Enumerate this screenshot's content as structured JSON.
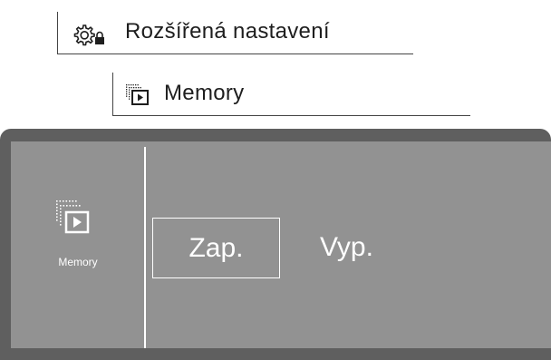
{
  "breadcrumb": {
    "level1": {
      "label": "Rozšířená nastavení",
      "icon": "gear-lock-icon"
    },
    "level2": {
      "label": "Memory",
      "icon": "memory-icon"
    }
  },
  "screen": {
    "sidebar": {
      "icon": "memory-icon",
      "label": "Memory"
    },
    "options": [
      {
        "label": "Zap.",
        "selected": true
      },
      {
        "label": "Vyp.",
        "selected": false
      }
    ]
  },
  "colors": {
    "panel_frame": "#5f5f5f",
    "screen_bg": "#929292",
    "screen_text": "#ffffff"
  }
}
